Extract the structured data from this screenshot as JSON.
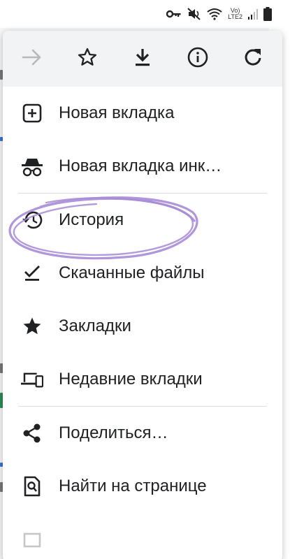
{
  "status_bar": {
    "volte_label": "Vo)",
    "lte_label": "LTE2"
  },
  "toolbar": {
    "forward_icon": "arrow-forward-icon",
    "bookmark_icon": "star-outline-icon",
    "download_icon": "download-icon",
    "info_icon": "info-icon",
    "refresh_icon": "refresh-icon"
  },
  "menu": {
    "items": [
      {
        "label": "Новая вкладка",
        "icon": "new-tab-icon"
      },
      {
        "label": "Новая вкладка инк…",
        "icon": "incognito-icon"
      },
      {
        "label": "История",
        "icon": "history-icon"
      },
      {
        "label": "Скачанные файлы",
        "icon": "downloads-check-icon"
      },
      {
        "label": "Закладки",
        "icon": "star-filled-icon"
      },
      {
        "label": "Недавние вкладки",
        "icon": "devices-icon"
      },
      {
        "label": "Поделиться…",
        "icon": "share-icon"
      },
      {
        "label": "Найти на странице",
        "icon": "find-in-page-icon"
      }
    ]
  },
  "annotation": {
    "color": "#a78bd6"
  }
}
